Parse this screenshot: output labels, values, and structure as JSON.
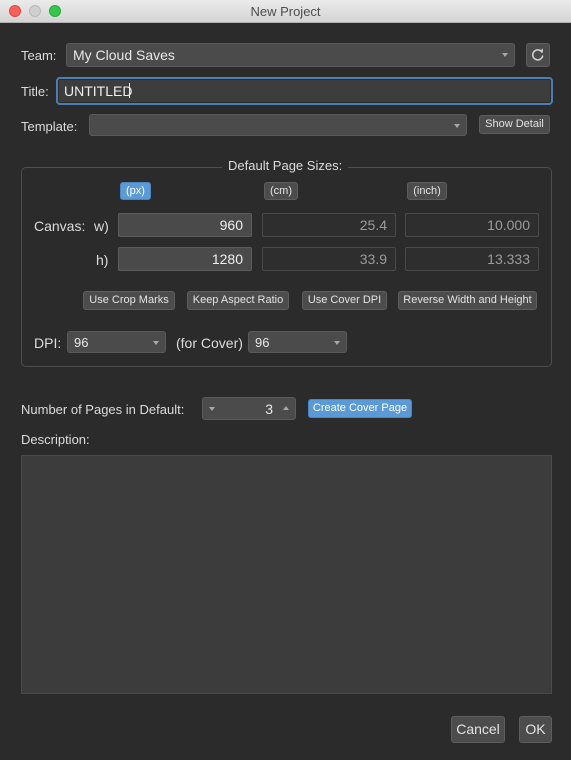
{
  "window": {
    "title": "New Project"
  },
  "team": {
    "label": "Team:",
    "value": "My Cloud Saves",
    "refresh_icon": "refresh-icon"
  },
  "title_field": {
    "label": "Title:",
    "value": "UNTITLED"
  },
  "template": {
    "label": "Template:",
    "value": "",
    "show_detail_label": "Show Detail"
  },
  "page_sizes": {
    "legend": "Default Page Sizes:",
    "units": {
      "px": "(px)",
      "cm": "(cm)",
      "inch": "(inch)"
    },
    "canvas_label": "Canvas:",
    "w_label": "w)",
    "h_label": "h)",
    "width": {
      "px": "960",
      "cm": "25.4",
      "inch": "10.000"
    },
    "height": {
      "px": "1280",
      "cm": "33.9",
      "inch": "13.333"
    },
    "buttons": {
      "crop_marks": "Use Crop Marks",
      "keep_aspect": "Keep Aspect Ratio",
      "cover_dpi": "Use Cover DPI",
      "reverse": "Reverse Width and Height"
    },
    "dpi_label": "DPI:",
    "dpi_value": "96",
    "cover_label": "(for Cover)",
    "cover_dpi_value": "96"
  },
  "pages": {
    "label": "Number of Pages in Default:",
    "value": "3",
    "create_cover_label": "Create Cover Page"
  },
  "description": {
    "label": "Description:",
    "value": ""
  },
  "footer": {
    "cancel_label": "Cancel",
    "ok_label": "OK"
  },
  "colors": {
    "accent": "#5a9ad6",
    "background": "#2b2b2b",
    "focus_ring": "#4a7fb5"
  }
}
